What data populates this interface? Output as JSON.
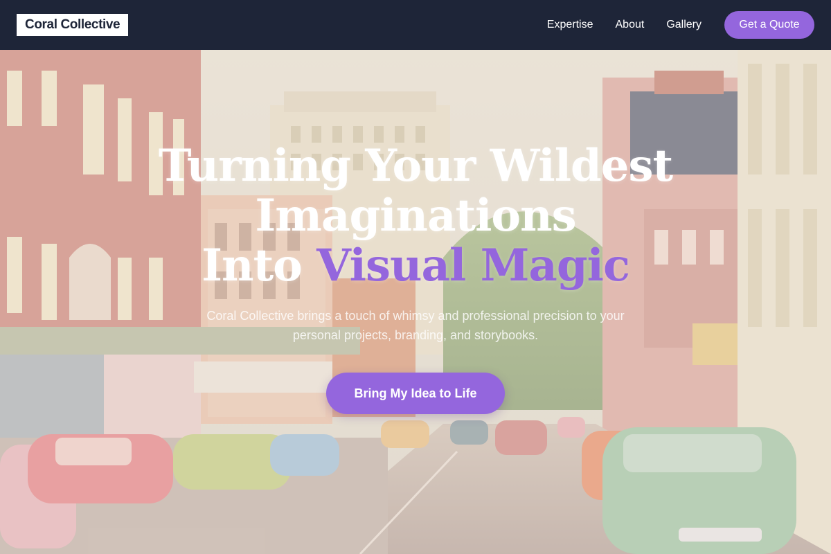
{
  "brand": {
    "logo_text": "Coral Collective"
  },
  "nav": {
    "links": [
      "Expertise",
      "About",
      "Gallery"
    ],
    "cta_label": "Get a Quote"
  },
  "hero": {
    "title_line1": "Turning Your Wildest",
    "title_line2": "Imaginations",
    "title_line3_plain": "Into ",
    "title_line3_accent": "Visual Magic",
    "subtitle": "Coral Collective brings a touch of whimsy and professional precision to your personal projects, branding, and storybooks.",
    "cta_label": "Bring My Idea to Life",
    "background_description": "vintage postcard of a downtown street with classic cars and storefronts"
  },
  "colors": {
    "navbar_bg": "#1e2538",
    "accent": "#9466dd",
    "text_light": "#ffffff"
  }
}
